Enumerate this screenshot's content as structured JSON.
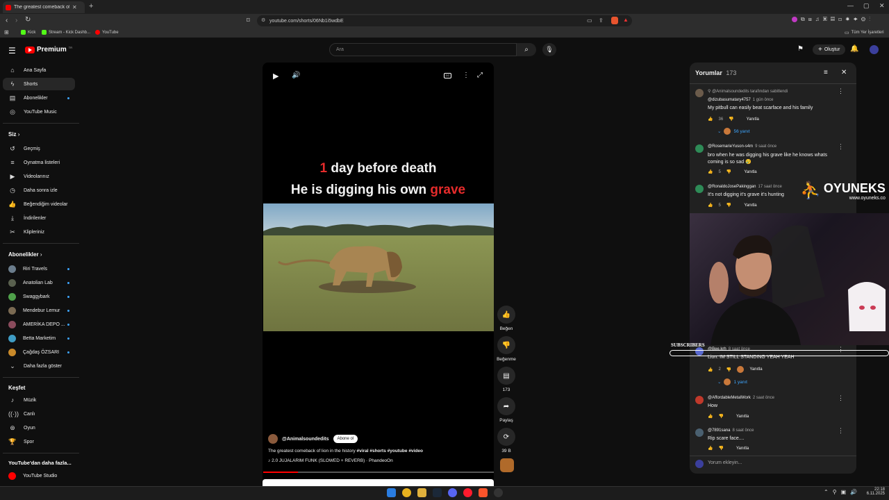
{
  "browser": {
    "tab_title": "The greatest comeback of lion",
    "url": "youtube.com/shorts/06Nb1i5wdbE",
    "bookmarks": [
      "Kick",
      "Stream - Kick Dashb...",
      "YouTube"
    ],
    "all_bookmarks": "Tüm Yer İşaretleri"
  },
  "header": {
    "logo": "Premium",
    "logo_sup": "TR",
    "search_placeholder": "Ara",
    "create_label": "Oluştur"
  },
  "sidebar": {
    "main": [
      "Ana Sayfa",
      "Shorts",
      "Abonelikler",
      "YouTube Music"
    ],
    "you_title": "Siz",
    "you": [
      "Geçmiş",
      "Oynatma listeleri",
      "Videolarınız",
      "Daha sonra izle",
      "Beğendiğim videolar",
      "İndirilenler",
      "Klipleriniz"
    ],
    "subs_title": "Abonelikler",
    "subs": [
      "Riri Travels",
      "Anatolian Lab",
      "Swaggybark",
      "Mendebur Lemur",
      "AMERİKA DEPO ...",
      "Betta Marketim",
      "Çağdaş ÖZSARI"
    ],
    "show_more": "Daha fazla göster",
    "explore_title": "Keşfet",
    "explore": [
      "Müzik",
      "Canlı",
      "Oyun",
      "Spor"
    ],
    "more_title": "YouTube'dan daha fazla...",
    "studio": "YouTube Studio"
  },
  "short": {
    "caption_num": "1",
    "caption_line1": " day before death",
    "caption_line2": "He is digging his own ",
    "caption_red": "grave",
    "channel": "@Animalsoundedits",
    "subscribe": "Abone ol",
    "title": "The greatest comeback of lion in the history",
    "hashtags": "#viral #shorts #youtube #video",
    "music": "2.0 JUJALARIM FUNK (SLOWED + REVERB) · PhandeoOn",
    "progress": 0.15
  },
  "actions": {
    "like": "Beğen",
    "dislike": "Beğenme",
    "comments": "173",
    "share": "Paylaş",
    "remix": "39 B"
  },
  "comments_panel": {
    "title": "Yorumlar",
    "count": "173",
    "pinned": "@Animalsoundedits tarafından sabitlendi",
    "reply_label": "Yanıtla",
    "input_placeholder": "Yorum ekleyin...",
    "comments": [
      {
        "user": "@dizubasumatary4757",
        "time": "1 gün önce",
        "text": "My pitbull can easily beat scarface and his family",
        "likes": "36",
        "replies": "56 yanıt"
      },
      {
        "user": "@RosemarieYuson-s4m",
        "time": "9 saat önce",
        "text": "bro when he was digging his grave like he knows whats coming is so sad 😢",
        "likes": "5"
      },
      {
        "user": "@RonaldoJosePakinggan",
        "time": "17 saat önce",
        "text": "It's not digging it's grave it's hunting",
        "likes": "5"
      },
      {
        "user": "@Bee.krh",
        "time": "8 saat önce",
        "text": "Lion: IM STILL STANDING YEAH YEAH",
        "likes": "2",
        "replies": "1 yanıt"
      },
      {
        "user": "@AffordableMetalWork",
        "time": "2 saat önce",
        "text": "How",
        "likes": ""
      },
      {
        "user": "@7891sana",
        "time": "8 saat önce",
        "text": "Rip scare face....",
        "likes": ""
      }
    ]
  },
  "overlay": {
    "brand": "OYUNEKS",
    "brand_url": "www.oyuneks.co",
    "subscribers_label": "SUBSCRIBERS"
  },
  "taskbar": {
    "time": "22:18",
    "date": "6.11.2025"
  }
}
